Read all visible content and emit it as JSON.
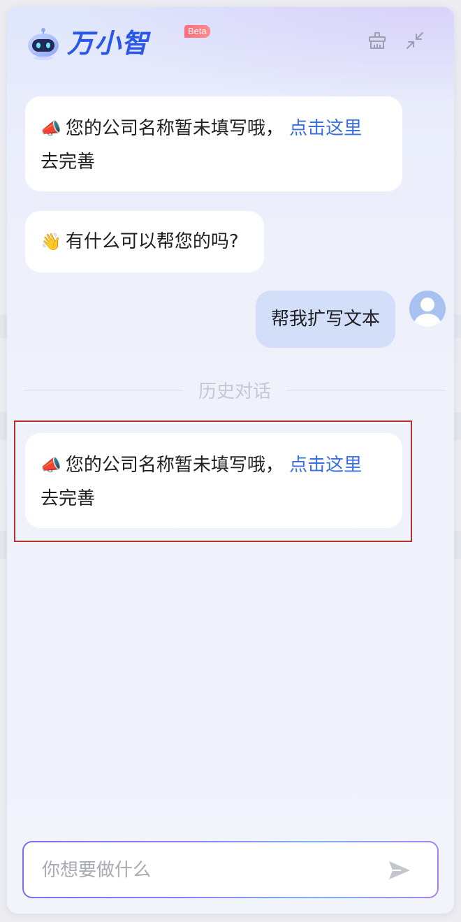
{
  "header": {
    "brand": "万小智",
    "badge": "Beta",
    "icons": [
      "broom-icon",
      "minimize-icon"
    ]
  },
  "messages": [
    {
      "role": "bot",
      "emoji": "📣",
      "text": "您的公司名称暂未填写哦，",
      "link": "点击这里",
      "suffix": "去完善"
    },
    {
      "role": "bot",
      "emoji": "👋",
      "text": "有什么可以帮您的吗?"
    },
    {
      "role": "user",
      "text": "帮我扩写文本"
    }
  ],
  "history": {
    "divider_label": "历史对话",
    "messages": [
      {
        "role": "bot",
        "emoji": "📣",
        "text": "您的公司名称暂未填写哦，",
        "link": "点击这里",
        "suffix": "去完善"
      }
    ]
  },
  "input": {
    "placeholder": "你想要做什么"
  },
  "colors": {
    "brand": "#2b57e8",
    "link": "#3a6fe0",
    "user_bubble": "#d3def9",
    "highlight": "#b8322c",
    "badge": "#ff6b79"
  }
}
